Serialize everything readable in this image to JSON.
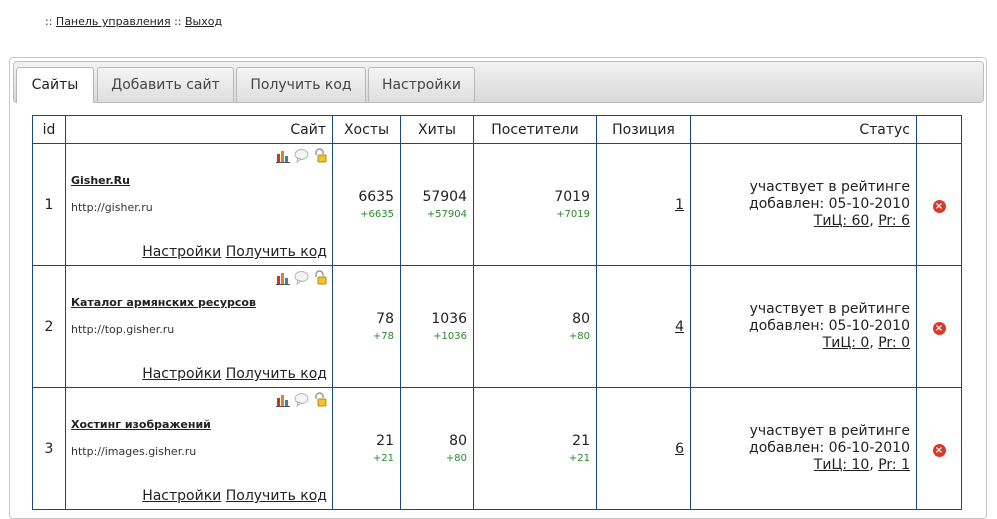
{
  "topnav": {
    "sep": "::",
    "panel": "Панель управления",
    "exit": "Выход"
  },
  "tabs": [
    {
      "label": "Сайты"
    },
    {
      "label": "Добавить сайт"
    },
    {
      "label": "Получить код"
    },
    {
      "label": "Настройки"
    }
  ],
  "table": {
    "headers": {
      "id": "id",
      "site": "Сайт",
      "hosts": "Хосты",
      "hits": "Хиты",
      "visitors": "Посетители",
      "position": "Позиция",
      "status": "Статус"
    },
    "link_settings": "Настройки",
    "link_code": "Получить код",
    "rows": [
      {
        "id": "1",
        "name": "Gisher.Ru",
        "url": "http://gisher.ru",
        "hosts": "6635",
        "hosts_d": "+6635",
        "hits": "57904",
        "hits_d": "+57904",
        "visitors": "7019",
        "visitors_d": "+7019",
        "position": "1",
        "status": "участвует в рейтинге",
        "added": "добавлен: 05-10-2010",
        "tic": "ТиЦ: 60",
        "pr": "Pr: 6"
      },
      {
        "id": "2",
        "name": "Каталог армянских ресурсов",
        "url": "http://top.gisher.ru",
        "hosts": "78",
        "hosts_d": "+78",
        "hits": "1036",
        "hits_d": "+1036",
        "visitors": "80",
        "visitors_d": "+80",
        "position": "4",
        "status": "участвует в рейтинге",
        "added": "добавлен: 05-10-2010",
        "tic": "ТиЦ: 0",
        "pr": "Pr: 0"
      },
      {
        "id": "3",
        "name": "Хостинг изображений",
        "url": "http://images.gisher.ru",
        "hosts": "21",
        "hosts_d": "+21",
        "hits": "80",
        "hits_d": "+80",
        "visitors": "21",
        "visitors_d": "+21",
        "position": "6",
        "status": "участвует в рейтинге",
        "added": "добавлен: 06-10-2010",
        "tic": "ТиЦ: 10",
        "pr": "Pr: 1"
      }
    ],
    "icons": [
      "stats-chart-icon",
      "comment-bubble-icon",
      "lock-icon"
    ],
    "delete_icon": "delete-icon",
    "delete_glyph": "×"
  }
}
